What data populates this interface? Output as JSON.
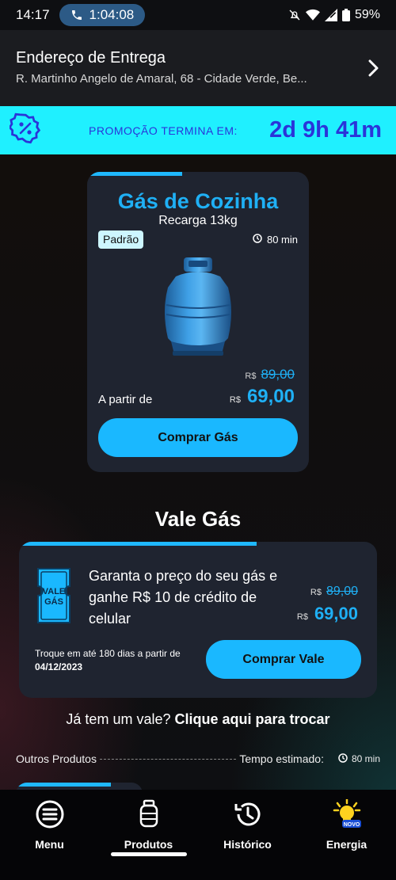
{
  "status_bar": {
    "time": "14:17",
    "call_duration": "1:04:08",
    "battery": "59%"
  },
  "header": {
    "title": "Endereço de Entrega",
    "address": "R. Martinho Angelo de Amaral, 68 - Cidade Verde, Be..."
  },
  "promo": {
    "label": "PROMOÇÃO TERMINA EM:",
    "countdown": "2d 9h 41m"
  },
  "gas_card": {
    "title": "Gás de Cozinha",
    "subtitle": "Recarga 13kg",
    "badge": "Padrão",
    "time": "80 min",
    "currency": "R$",
    "old_price": "89,00",
    "from_label": "A partir de",
    "price": "69,00",
    "button": "Comprar Gás"
  },
  "vale": {
    "section_title": "Vale Gás",
    "ticket_text_1": "VALE",
    "ticket_text_2": "GÁS",
    "description": "Garanta o preço do seu gás e ganhe R$ 10 de crédito de celular",
    "currency": "R$",
    "old_price": "89,00",
    "price": "69,00",
    "note": "Troque em até 180 dias a partir de",
    "note_date": "04/12/2023",
    "button": "Comprar Vale"
  },
  "has_vale": {
    "question": "Já tem um vale?",
    "link": "Clique aqui para trocar"
  },
  "others": {
    "label": "Outros Produtos",
    "eta_label": "Tempo estimado:",
    "eta_value": "80 min"
  },
  "nav": {
    "items": [
      {
        "label": "Menu"
      },
      {
        "label": "Produtos"
      },
      {
        "label": "Histórico"
      },
      {
        "label": "Energia",
        "badge": "NOVO"
      }
    ]
  },
  "colors": {
    "accent": "#1fb0f5",
    "promo_bg": "#1ff0ff",
    "promo_text": "#2a35d9",
    "card_bg": "#1f2430"
  }
}
